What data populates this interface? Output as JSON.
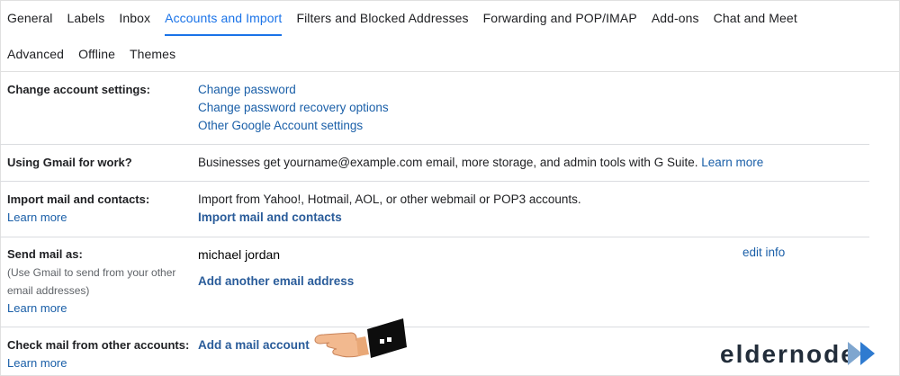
{
  "tabs": {
    "row1": [
      {
        "label": "General"
      },
      {
        "label": "Labels"
      },
      {
        "label": "Inbox"
      },
      {
        "label": "Accounts and Import",
        "active": true
      },
      {
        "label": "Filters and Blocked Addresses"
      },
      {
        "label": "Forwarding and POP/IMAP"
      },
      {
        "label": "Add-ons"
      },
      {
        "label": "Chat and Meet"
      }
    ],
    "row2": [
      {
        "label": "Advanced"
      },
      {
        "label": "Offline"
      },
      {
        "label": "Themes"
      }
    ]
  },
  "change_account": {
    "label": "Change account settings:",
    "links": [
      "Change password",
      "Change password recovery options",
      "Other Google Account settings"
    ]
  },
  "gmail_work": {
    "label": "Using Gmail for work?",
    "text": "Businesses get yourname@example.com email, more storage, and admin tools with G Suite.",
    "link": "Learn more"
  },
  "import_mail": {
    "label": "Import mail and contacts:",
    "learn_more": "Learn more",
    "text": "Import from Yahoo!, Hotmail, AOL, or other webmail or POP3 accounts.",
    "action": "Import mail and contacts"
  },
  "send_mail": {
    "label": "Send mail as:",
    "note_line1": "(Use Gmail to send from your other",
    "note_line2": "email addresses)",
    "learn_more": "Learn more",
    "sender_name": "michael jordan",
    "edit": "edit info",
    "action": "Add another email address"
  },
  "check_mail": {
    "label": "Check mail from other accounts:",
    "learn_more": "Learn more",
    "action": "Add a mail account"
  },
  "watermark": {
    "text": "eldernode"
  },
  "colors": {
    "link": "#1a5fa8",
    "active_tab": "#1a73e8",
    "divider": "#dadce0"
  }
}
